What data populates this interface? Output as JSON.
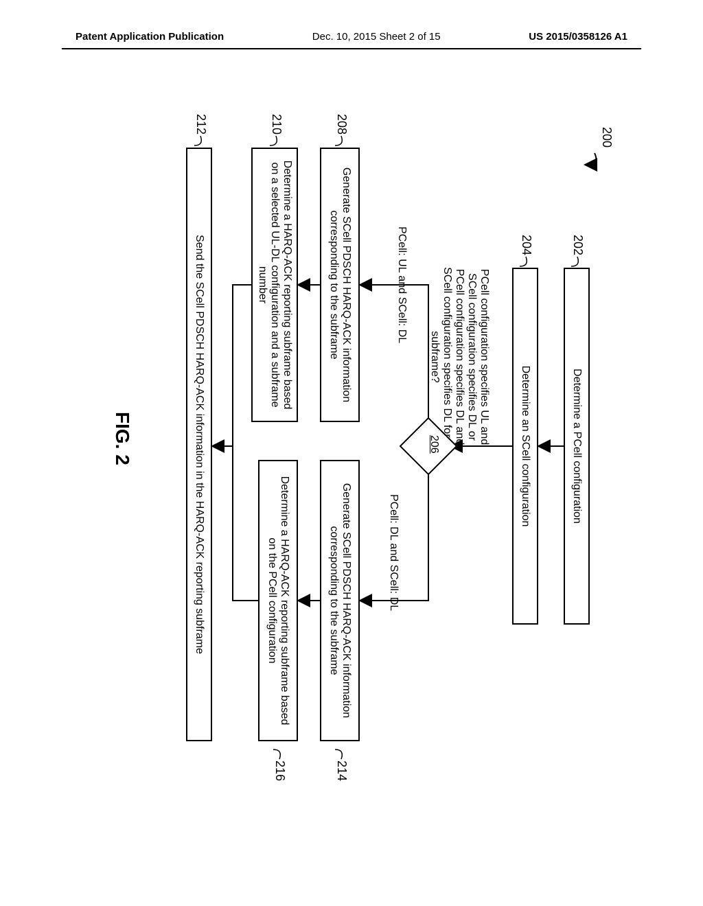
{
  "header": {
    "left": "Patent Application Publication",
    "center": "Dec. 10, 2015  Sheet 2 of 15",
    "right": "US 2015/0358126 A1"
  },
  "refs": {
    "r200": "200",
    "r202": "202",
    "r204": "204",
    "r206": "206",
    "r208": "208",
    "r210": "210",
    "r212": "212",
    "r214": "214",
    "r216": "216"
  },
  "boxes": {
    "b202": "Determine a PCell configuration",
    "b204": "Determine an SCell configuration",
    "b208": "Generate SCell PDSCH HARQ-ACK information corresponding to the subframe",
    "b210": "Determine a HARQ-ACK reporting subframe based on a selected UL-DL configuration and a subframe number",
    "b212": "Send the SCell PDSCH HARQ-ACK information in the HARQ-ACK reporting subframe",
    "b214": "Generate SCell PDSCH HARQ-ACK information corresponding to the subframe",
    "b216": "Determine a HARQ-ACK reporting subframe based on the PCell configuration"
  },
  "diamond": {
    "text": "PCell configuration specifies UL and SCell configuration specifies DL or PCell configuration specifies DL and SCell configuration specifies DL for a subframe?",
    "left": "PCell: UL and SCell: DL",
    "right": "PCell: DL and SCell: DL"
  },
  "figure": "FIG. 2",
  "chart_data": {
    "type": "flowchart",
    "nodes": [
      {
        "id": "200",
        "type": "label",
        "text": "200"
      },
      {
        "id": "202",
        "type": "process",
        "text": "Determine a PCell configuration"
      },
      {
        "id": "204",
        "type": "process",
        "text": "Determine an SCell configuration"
      },
      {
        "id": "206",
        "type": "decision",
        "text": "PCell configuration specifies UL and SCell configuration specifies DL or PCell configuration specifies DL and SCell configuration specifies DL for a subframe?"
      },
      {
        "id": "208",
        "type": "process",
        "text": "Generate SCell PDSCH HARQ-ACK information corresponding to the subframe"
      },
      {
        "id": "210",
        "type": "process",
        "text": "Determine a HARQ-ACK reporting subframe based on a selected UL-DL configuration and a subframe number"
      },
      {
        "id": "212",
        "type": "process",
        "text": "Send the SCell PDSCH HARQ-ACK information in the HARQ-ACK reporting subframe"
      },
      {
        "id": "214",
        "type": "process",
        "text": "Generate SCell PDSCH HARQ-ACK information corresponding to the subframe"
      },
      {
        "id": "216",
        "type": "process",
        "text": "Determine a HARQ-ACK reporting subframe based on the PCell configuration"
      }
    ],
    "edges": [
      {
        "from": "202",
        "to": "204"
      },
      {
        "from": "204",
        "to": "206"
      },
      {
        "from": "206",
        "to": "208",
        "label": "PCell: UL and SCell: DL"
      },
      {
        "from": "206",
        "to": "214",
        "label": "PCell: DL and SCell: DL"
      },
      {
        "from": "208",
        "to": "210"
      },
      {
        "from": "214",
        "to": "216"
      },
      {
        "from": "210",
        "to": "212"
      },
      {
        "from": "216",
        "to": "212"
      }
    ],
    "title": "FIG. 2"
  }
}
